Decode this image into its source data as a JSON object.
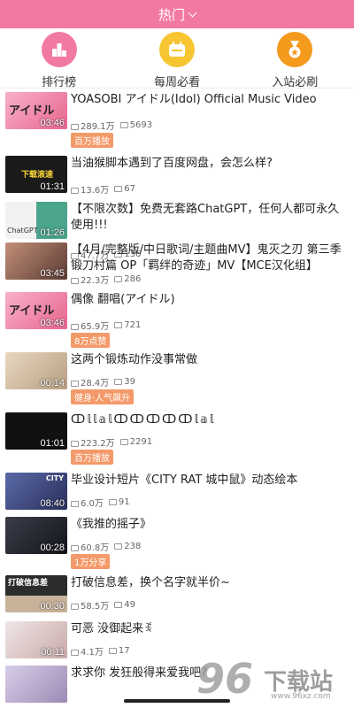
{
  "topbar": {
    "title": "热门"
  },
  "shortcuts": [
    {
      "label": "排行榜"
    },
    {
      "label": "每周必看"
    },
    {
      "label": "入站必刷"
    }
  ],
  "videos": [
    {
      "title": "YOASOBI アイドル(Idol) Official Music Video",
      "duration": "03:46",
      "views": "289.1万",
      "comments": "5693",
      "badge": "百万播放",
      "thumb_text": "アイドル"
    },
    {
      "title": "当油猴脚本遇到了百度网盘，会怎么样?",
      "duration": "01:31",
      "views": "13.6万",
      "comments": "67",
      "badge": "",
      "thumb_text": "下载滚速"
    },
    {
      "title": "【不限次数】免费无套路ChatGPT，任何人都可永久使用!!!",
      "duration": "01:26",
      "views": "47.7万",
      "comments": "136",
      "badge": "",
      "thumb_text": "ChatGPT"
    },
    {
      "title": "【4月/完整版/中日歌词/主题曲MV】鬼灭之刃 第三季 锻刀村篇 OP「羁绊的奇迹」MV【MCE汉化组】",
      "duration": "03:45",
      "views": "22.3万",
      "comments": "286",
      "badge": "",
      "thumb_text": ""
    },
    {
      "title": "偶像 翻唱(アイドル)",
      "duration": "03:46",
      "views": "65.9万",
      "comments": "721",
      "badge": "8万点赞",
      "thumb_text": "アイドル"
    },
    {
      "title": "这两个锻炼动作没事常做",
      "duration": "00:14",
      "views": "28.4万",
      "comments": "39",
      "badge": "健身·人气飙升",
      "thumb_text": ""
    },
    {
      "title": "ↀ𝕝𝕝𝕒𝕝ↀↀↀↀↀ𝕝𝕒𝕝",
      "duration": "01:01",
      "views": "223.2万",
      "comments": "2291",
      "badge": "百万播放",
      "thumb_text": ""
    },
    {
      "title": "毕业设计短片《CITY RAT 城中鼠》动态绘本",
      "duration": "08:40",
      "views": "6.0万",
      "comments": "91",
      "badge": "",
      "thumb_text": "CITY"
    },
    {
      "title": "《我推的摇子》",
      "duration": "00:28",
      "views": "60.8万",
      "comments": "238",
      "badge": "1万分享",
      "thumb_text": ""
    },
    {
      "title": "打破信息差，换个名字就半价~",
      "duration": "00:30",
      "views": "58.5万",
      "comments": "49",
      "badge": "",
      "thumb_text": "打破信息差"
    },
    {
      "title": "可恶 没御起来ꉂ",
      "duration": "00:11",
      "views": "4.1万",
      "comments": "17",
      "badge": "",
      "thumb_text": ""
    },
    {
      "title": "求求你 发狂般得来爱我吧?",
      "duration": "",
      "views": "",
      "comments": "",
      "badge": "",
      "thumb_text": ""
    }
  ],
  "watermark": {
    "number": "96",
    "text": "下载站",
    "url": "www.96xz.com"
  },
  "colors": {
    "accent": "#f27aa0",
    "badge": "#f49a6a"
  }
}
